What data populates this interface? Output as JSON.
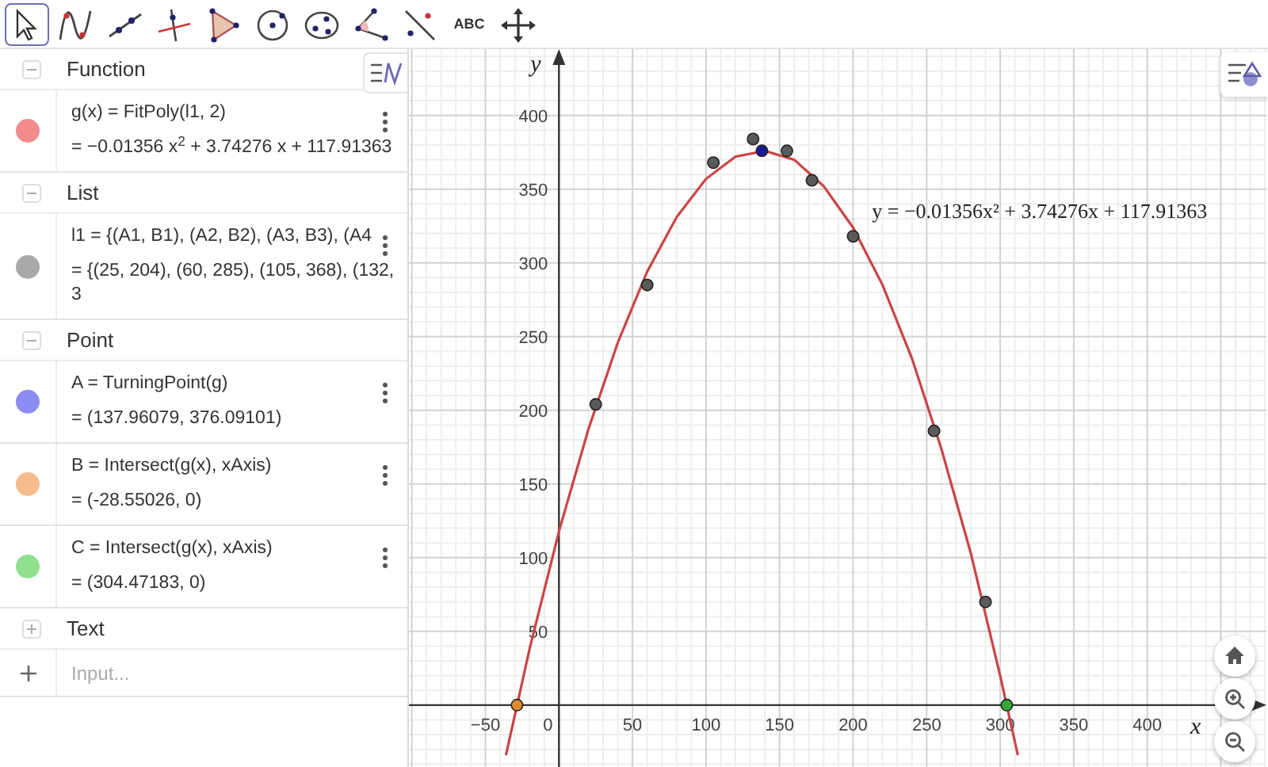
{
  "toolbar": [
    {
      "kind": "move",
      "selected": true
    },
    {
      "kind": "function",
      "selected": false
    },
    {
      "kind": "line",
      "selected": false
    },
    {
      "kind": "perpendicular",
      "selected": false
    },
    {
      "kind": "polygon",
      "selected": false
    },
    {
      "kind": "circle",
      "selected": false
    },
    {
      "kind": "conic",
      "selected": false
    },
    {
      "kind": "angle",
      "selected": false
    },
    {
      "kind": "reflect",
      "selected": false
    },
    {
      "kind": "text",
      "selected": false,
      "label": "ABC"
    },
    {
      "kind": "pan",
      "selected": false
    }
  ],
  "algebra": {
    "groups": [
      {
        "title": "Function",
        "expanded": true,
        "items": [
          {
            "color": "#f28b8b",
            "definition": "g(x) = FitPoly(l1, 2)",
            "value": "= −0.01356 x$^{2}$ + 3.74276 x + 117.91363"
          }
        ]
      },
      {
        "title": "List",
        "expanded": true,
        "items": [
          {
            "color": "#a9a9a9",
            "definition": "l1 = {(A1, B1), (A2, B2), (A3, B3), (A4",
            "value": "= {(25, 204), (60, 285), (105, 368), (132, 3"
          }
        ]
      },
      {
        "title": "Point",
        "expanded": true,
        "items": [
          {
            "color": "#8c8cf2",
            "definition": "A = TurningPoint(g)",
            "value": "= (137.96079, 376.09101)"
          },
          {
            "color": "#f8bb8c",
            "definition": "B = Intersect(g(x), xAxis)",
            "value": "= (-28.55026, 0)"
          },
          {
            "color": "#8fe08f",
            "definition": "C = Intersect(g(x), xAxis)",
            "value": "= (304.47183, 0)"
          }
        ]
      },
      {
        "title": "Text",
        "expanded": false
      }
    ],
    "input": {
      "placeholder": "Input..."
    }
  },
  "graphics": {
    "chart_data": {
      "type": "scatter",
      "xlabel": "x",
      "ylabel": "y",
      "xlim": [
        -102,
        481
      ],
      "ylim": [
        -42,
        445
      ],
      "xticks": [
        {
          "value": -50,
          "label": "−50"
        },
        50,
        100,
        150,
        200,
        250,
        300,
        350,
        400
      ],
      "yticks": [
        50,
        100,
        150,
        200,
        250,
        300,
        350,
        400
      ],
      "series": [
        {
          "type": "line",
          "color": "#cc4444",
          "x": [
            -36,
            -20,
            0,
            20,
            40,
            60,
            80,
            100,
            120,
            140,
            160,
            180,
            200,
            220,
            240,
            260,
            280,
            300,
            312
          ],
          "values": [
            -34,
            38,
            118,
            187,
            246,
            294,
            331,
            357,
            372,
            376,
            370,
            352,
            324,
            285,
            235,
            174,
            103,
            20,
            -34
          ]
        },
        {
          "color": "#5a5a5a",
          "x": [
            25,
            60,
            105,
            132,
            155,
            172,
            200,
            255,
            290
          ],
          "values": [
            204,
            285,
            368,
            384,
            376,
            356,
            318,
            186,
            70
          ]
        },
        {
          "color": "#1a1a99",
          "x": [
            138
          ],
          "values": [
            376
          ]
        },
        {
          "color": "#e08a2a",
          "x": [
            -28.5
          ],
          "values": [
            0
          ]
        },
        {
          "color": "#33aa33",
          "x": [
            304.5
          ],
          "values": [
            0
          ]
        }
      ],
      "grid": true,
      "annotations": [
        "y = −0.01356x² + 3.74276x + 117.91363"
      ]
    },
    "origin_label": "0"
  }
}
